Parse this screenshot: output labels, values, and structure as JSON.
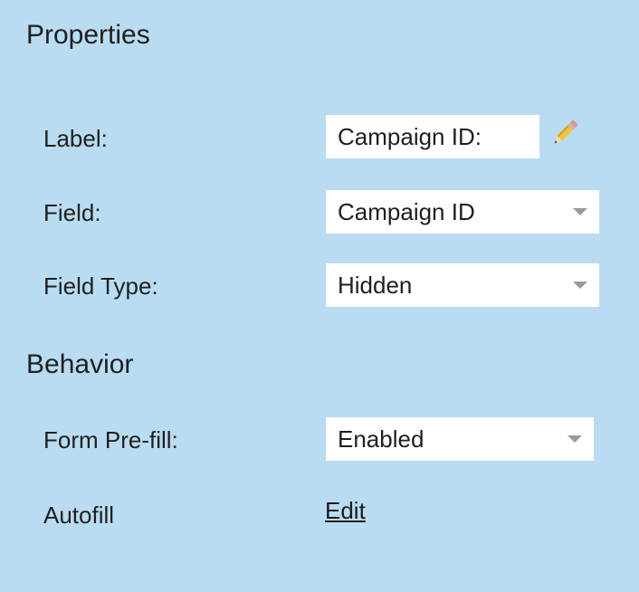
{
  "properties": {
    "title": "Properties",
    "label": {
      "label": "Label:",
      "value": "Campaign ID:",
      "edit_icon": "pencil-icon"
    },
    "field": {
      "label": "Field:",
      "value": "Campaign ID",
      "icon": "chevron-down-icon"
    },
    "field_type": {
      "label": "Field Type:",
      "value": "Hidden",
      "icon": "chevron-down-icon"
    }
  },
  "behavior": {
    "title": "Behavior",
    "form_prefill": {
      "label": "Form Pre-fill:",
      "value": "Enabled",
      "icon": "chevron-down-icon"
    },
    "autofill": {
      "label": "Autofill",
      "link": "Edit"
    }
  },
  "colors": {
    "background": "#badcf2",
    "control_background": "#ffffff",
    "text": "#1f1f1f",
    "caret": "#9a9a9a"
  }
}
